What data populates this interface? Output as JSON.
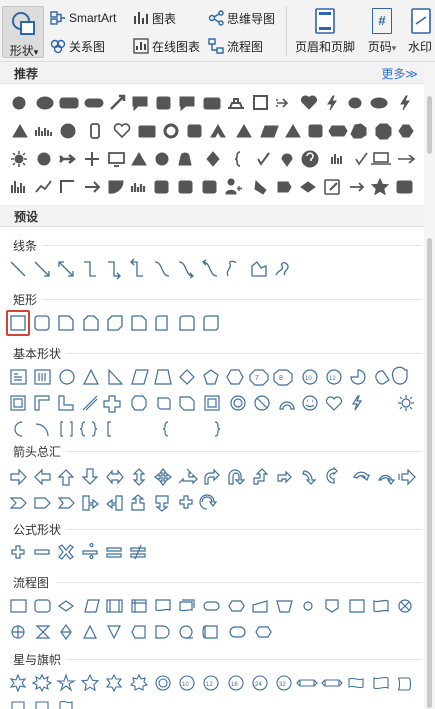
{
  "ribbon": {
    "shape_label": "形状",
    "smartart_label": "SmartArt",
    "chart_label": "图表",
    "mindmap_label": "思维导图",
    "relation_label": "关系图",
    "online_chart_label": "在线图表",
    "flowchart_label": "流程图",
    "header_footer_label": "页眉和页脚",
    "page_number_label": "页码",
    "watermark_label": "水印",
    "dropdown_glyph": "▾",
    "page_number_glyph": "#"
  },
  "recommended": {
    "title": "推荐",
    "more": "更多≫"
  },
  "presets": {
    "title": "预设",
    "categories": {
      "lines": "线条",
      "rect": "矩形",
      "basic": "基本形状",
      "arrows": "箭头总汇",
      "formula": "公式形状",
      "flowchart": "流程图",
      "stars": "星与旗帜"
    }
  },
  "colors": {
    "ribbon_bg": "#f3f3f3",
    "icon_dark": "#555555",
    "icon_blue": "#3f6f9f",
    "accent_link": "#2f6fd6",
    "selected_border": "#d84234"
  }
}
